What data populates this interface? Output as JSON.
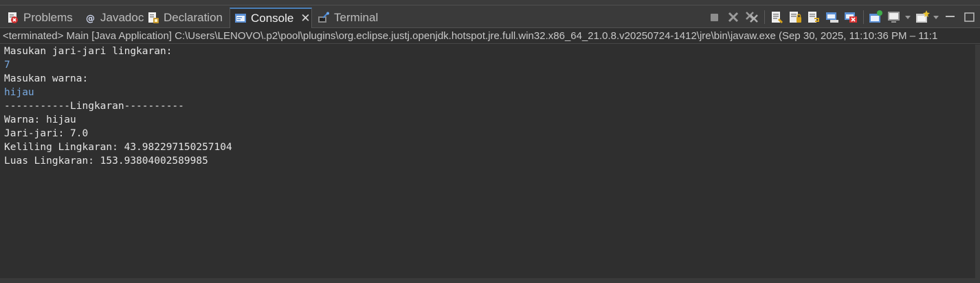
{
  "tabs": [
    {
      "label": "Problems",
      "icon": "problems-icon"
    },
    {
      "label": "Javadoc",
      "icon": "javadoc-icon"
    },
    {
      "label": "Declaration",
      "icon": "declaration-icon"
    },
    {
      "label": "Console",
      "icon": "console-icon",
      "active": true
    },
    {
      "label": "Terminal",
      "icon": "terminal-icon"
    }
  ],
  "toolbar_icons": [
    "terminate-icon",
    "remove-launch-icon",
    "remove-all-terminated-icon",
    "clear-console-icon",
    "scroll-lock-icon",
    "word-wrap-icon",
    "show-on-stdout-icon",
    "show-on-stderr-icon",
    "pin-console-icon",
    "display-console-icon",
    "open-console-icon",
    "minimize-icon",
    "maximize-icon"
  ],
  "status": "<terminated> Main [Java Application] C:\\Users\\LENOVO\\.p2\\pool\\plugins\\org.eclipse.justj.openjdk.hotspot.jre.full.win32.x86_64_21.0.8.v20250724-1412\\jre\\bin\\javaw.exe  (Sep 30, 2025, 11:10:36 PM – 11:1",
  "console_lines": [
    {
      "text": "Masukan jari-jari lingkaran:",
      "kind": "output"
    },
    {
      "text": "7",
      "kind": "input"
    },
    {
      "text": "Masukan warna:",
      "kind": "output"
    },
    {
      "text": "hijau",
      "kind": "input"
    },
    {
      "text": "-----------Lingkaran----------",
      "kind": "output"
    },
    {
      "text": "Warna: hijau",
      "kind": "output"
    },
    {
      "text": "Jari-jari: 7.0",
      "kind": "output"
    },
    {
      "text": "Keliling Lingkaran: 43.982297150257104",
      "kind": "output"
    },
    {
      "text": "Luas Lingkaran: 153.93804002589985",
      "kind": "output"
    }
  ],
  "colors": {
    "background": "#2f2f2f",
    "stdout": "#e6e6e6",
    "stdin": "#78a9e0",
    "active_tab_border": "#4a7fb8"
  }
}
